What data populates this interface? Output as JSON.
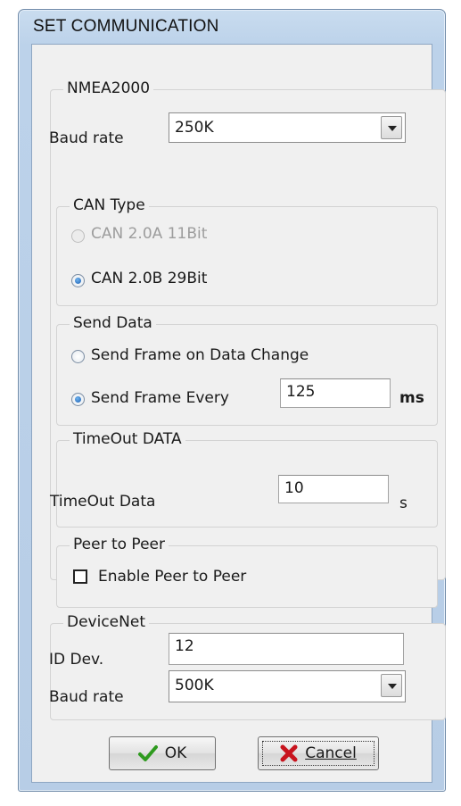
{
  "window": {
    "title": "SET COMMUNICATION"
  },
  "nmea2000": {
    "legend": "NMEA2000",
    "baud_label": "Baud rate",
    "baud_value": "250K",
    "can_type": {
      "legend": "CAN Type",
      "option_a": "CAN 2.0A 11Bit",
      "option_b": "CAN 2.0B 29Bit"
    },
    "send_data": {
      "legend": "Send Data",
      "option_change": "Send Frame on Data Change",
      "option_every": "Send Frame Every",
      "every_value": "125",
      "every_unit": "ms"
    },
    "timeout": {
      "legend": "TimeOut DATA",
      "label": "TimeOut Data",
      "value": "10",
      "unit": "s"
    },
    "peer": {
      "legend": "Peer to Peer",
      "enable_label": "Enable Peer to Peer"
    }
  },
  "devicenet": {
    "legend": "DeviceNet",
    "id_label": "ID Dev.",
    "id_value": "12",
    "baud_label": "Baud rate",
    "baud_value": "500K"
  },
  "buttons": {
    "ok": "OK",
    "cancel": "Cancel"
  },
  "colors": {
    "ok_check": "#2e9a1e",
    "cancel_x": "#c8141e",
    "radio_checked": "#1c5fb3"
  },
  "icons": {
    "ok": "checkmark-icon",
    "cancel": "x-icon"
  }
}
